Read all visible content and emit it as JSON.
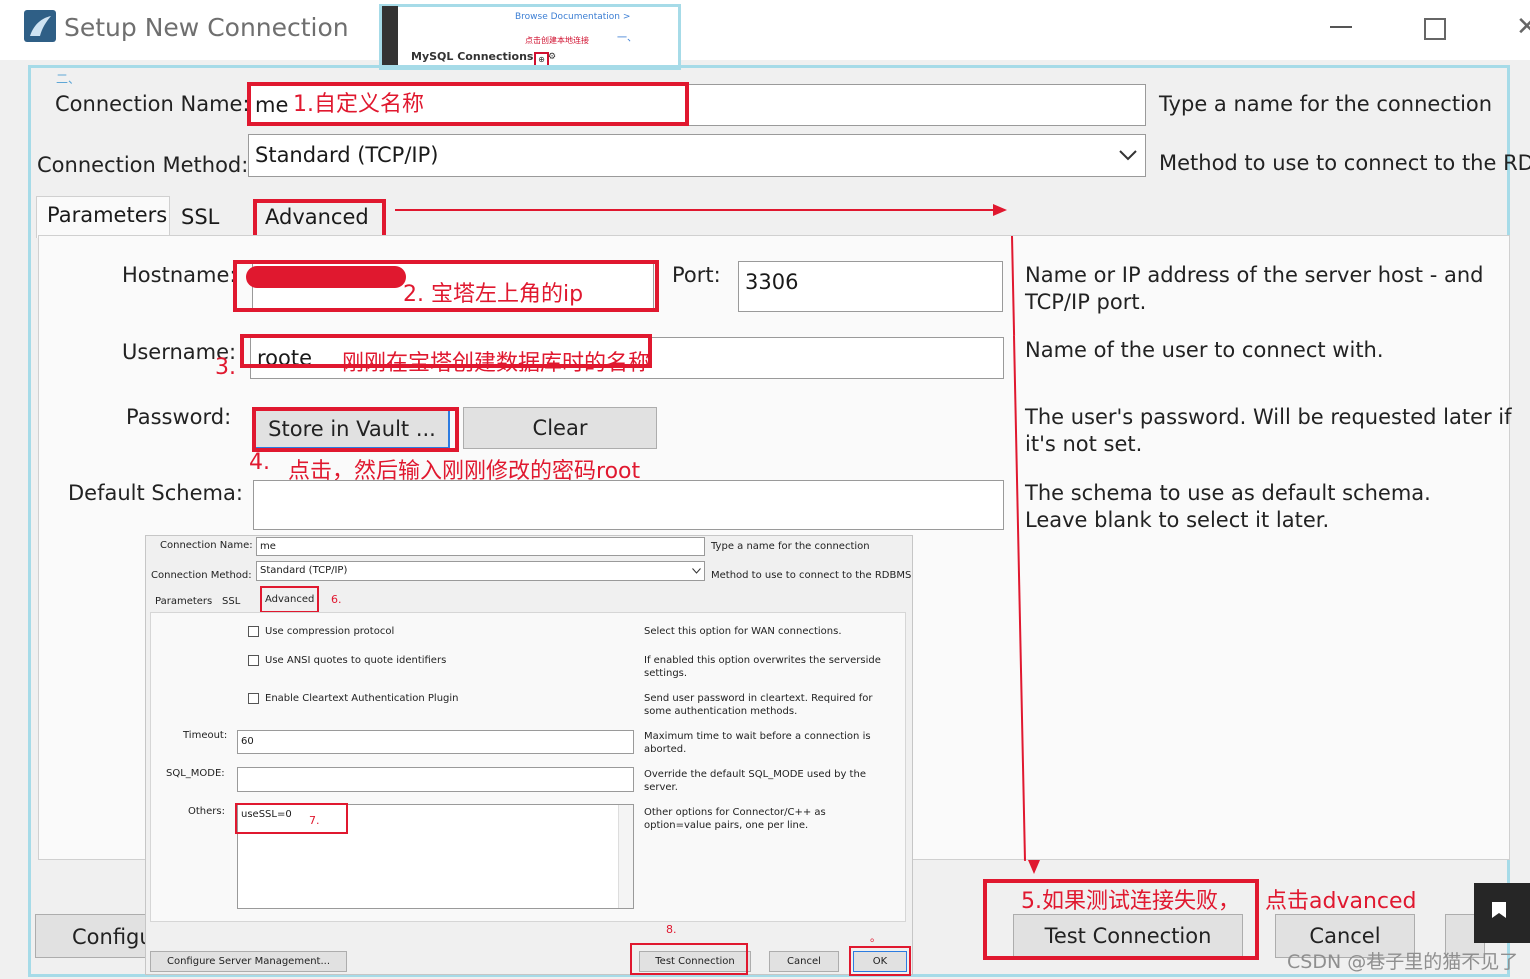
{
  "window": {
    "title": "Setup New Connection",
    "minimize_icon": "minimize-icon",
    "maximize_icon": "maximize-icon",
    "close_icon": "close-icon",
    "close_glyph": "✕"
  },
  "thumbnail": {
    "browse_docs": "Browse Documentation >",
    "red_note": "点击创建本地连接",
    "blue_mark": "一、",
    "connections_label": "MySQL Connections",
    "plus_glyph": "⊕",
    "cog_glyph": "⚙"
  },
  "step_marker_two": "二、",
  "form": {
    "connection_name_label": "Connection Name:",
    "connection_name_value": "me",
    "connection_name_desc": "Type a name for the connection",
    "connection_method_label": "Connection Method:",
    "connection_method_value": "Standard (TCP/IP)",
    "connection_method_desc": "Method to use to connect to the RDBMS"
  },
  "tabs": {
    "parameters": "Parameters",
    "ssl": "SSL",
    "advanced": "Advanced"
  },
  "parameters": {
    "hostname_label": "Hostname:",
    "port_label": "Port:",
    "port_value": "3306",
    "hostname_desc": "Name or IP address of the server host - and TCP/IP port.",
    "username_label": "Username:",
    "username_value": "roote",
    "username_desc": "Name of the user to connect with.",
    "password_label": "Password:",
    "store_in_vault": "Store in Vault ...",
    "clear": "Clear",
    "password_desc": "The user's password. Will be requested later if it's not set.",
    "default_schema_label": "Default Schema:",
    "default_schema_value": "",
    "default_schema_desc": "The schema to use as default schema. Leave blank to select it later."
  },
  "annotations": {
    "a1": "1.自定义名称",
    "a2": "2. 宝塔左上角的ip",
    "a3_num": "3.",
    "a3": "刚刚在宝塔创建数据库时的名称",
    "a4_num": "4.",
    "a4": "点击，然后输入刚刚修改的密码root",
    "a5": "5.如果测试连接失败，",
    "a5b": "点击advanced",
    "a6": "6.",
    "a7": "7.",
    "a8": "8.",
    "a9": "。"
  },
  "bottom_buttons": {
    "configure": "Configu",
    "test_connection": "Test Connection",
    "cancel": "Cancel"
  },
  "inset": {
    "connection_name_label": "Connection Name:",
    "connection_name_value": "me",
    "connection_name_desc": "Type a name for the connection",
    "connection_method_label": "Connection Method:",
    "connection_method_value": "Standard (TCP/IP)",
    "connection_method_desc": "Method to use to connect to the RDBMS",
    "tab_parameters": "Parameters",
    "tab_ssl": "SSL",
    "tab_advanced": "Advanced",
    "compression_label": "Use compression protocol",
    "compression_desc": "Select this option for WAN connections.",
    "ansi_label": "Use ANSI quotes to quote identifiers",
    "ansi_desc": "If enabled this option overwrites the serverside settings.",
    "cleartext_label": "Enable Cleartext Authentication Plugin",
    "cleartext_desc": "Send user password in cleartext. Required for some authentication methods.",
    "timeout_label": "Timeout:",
    "timeout_value": "60",
    "timeout_desc": "Maximum time to wait before a connection is aborted.",
    "sql_mode_label": "SQL_MODE:",
    "sql_mode_value": "",
    "sql_mode_desc": "Override the default SQL_MODE used by the server.",
    "others_label": "Others:",
    "others_value": "useSSL=0",
    "others_desc": "Other options for Connector/C++ as option=value pairs, one per line.",
    "configure_server": "Configure Server Management...",
    "test_connection": "Test Connection",
    "cancel": "Cancel",
    "ok": "OK"
  },
  "watermark": "CSDN @巷子里的猫不见了",
  "colors": {
    "annotation_red": "#e0182f",
    "frame_blue": "#a6dbe8",
    "window_bg": "#f0f0f0"
  }
}
